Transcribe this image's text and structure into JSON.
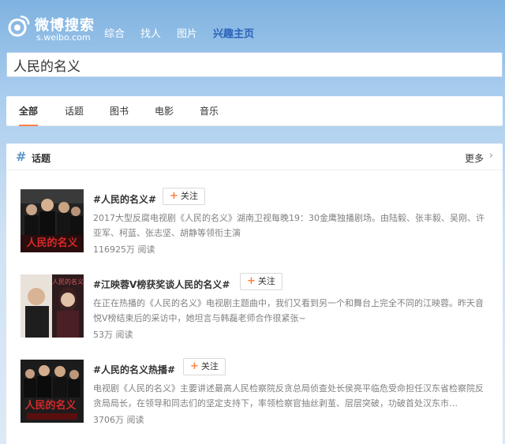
{
  "logo": {
    "title": "微博搜索",
    "subtitle": "s.weibo.com"
  },
  "top_nav": [
    "综合",
    "找人",
    "图片",
    "兴趣主页"
  ],
  "search": {
    "value": "人民的名义"
  },
  "tabs": [
    "全部",
    "话题",
    "图书",
    "电影",
    "音乐"
  ],
  "topics_card": {
    "title": "话题",
    "more": "更多",
    "items": [
      {
        "title": "#人民的名义#",
        "follow": "关注",
        "desc": "2017大型反腐电视剧《人民的名义》湖南卫视每晚19：30金鹰独播剧场。由陆毅、张丰毅、吴刚、许亚军、柯蓝、张志坚、胡静等领衔主演",
        "reads": "116925万 阅读"
      },
      {
        "title": "#江映蓉V榜获奖谈人民的名义#",
        "follow": "关注",
        "desc": "在正在热播的《人民的名义》电视剧主题曲中，我们又看到另一个和舞台上完全不同的江映蓉。昨天音悦V榜结束后的采访中，她坦言与韩磊老师合作很紧张~",
        "reads": "53万 阅读"
      },
      {
        "title": "#人民的名义热播#",
        "follow": "关注",
        "desc": "电视剧《人民的名义》主要讲述最高人民检察院反贪总局侦查处长侯亮平临危受命担任汉东省检察院反贪局局长，在领导和同志们的坚定支持下，率领检察官抽丝剥茧、层层突破，功破首处汉东市…",
        "reads": "3706万 阅读"
      }
    ]
  },
  "colors": {
    "accent": "#ff8140",
    "link_blue": "#2b62b8",
    "hash_blue": "#5a93c9"
  }
}
